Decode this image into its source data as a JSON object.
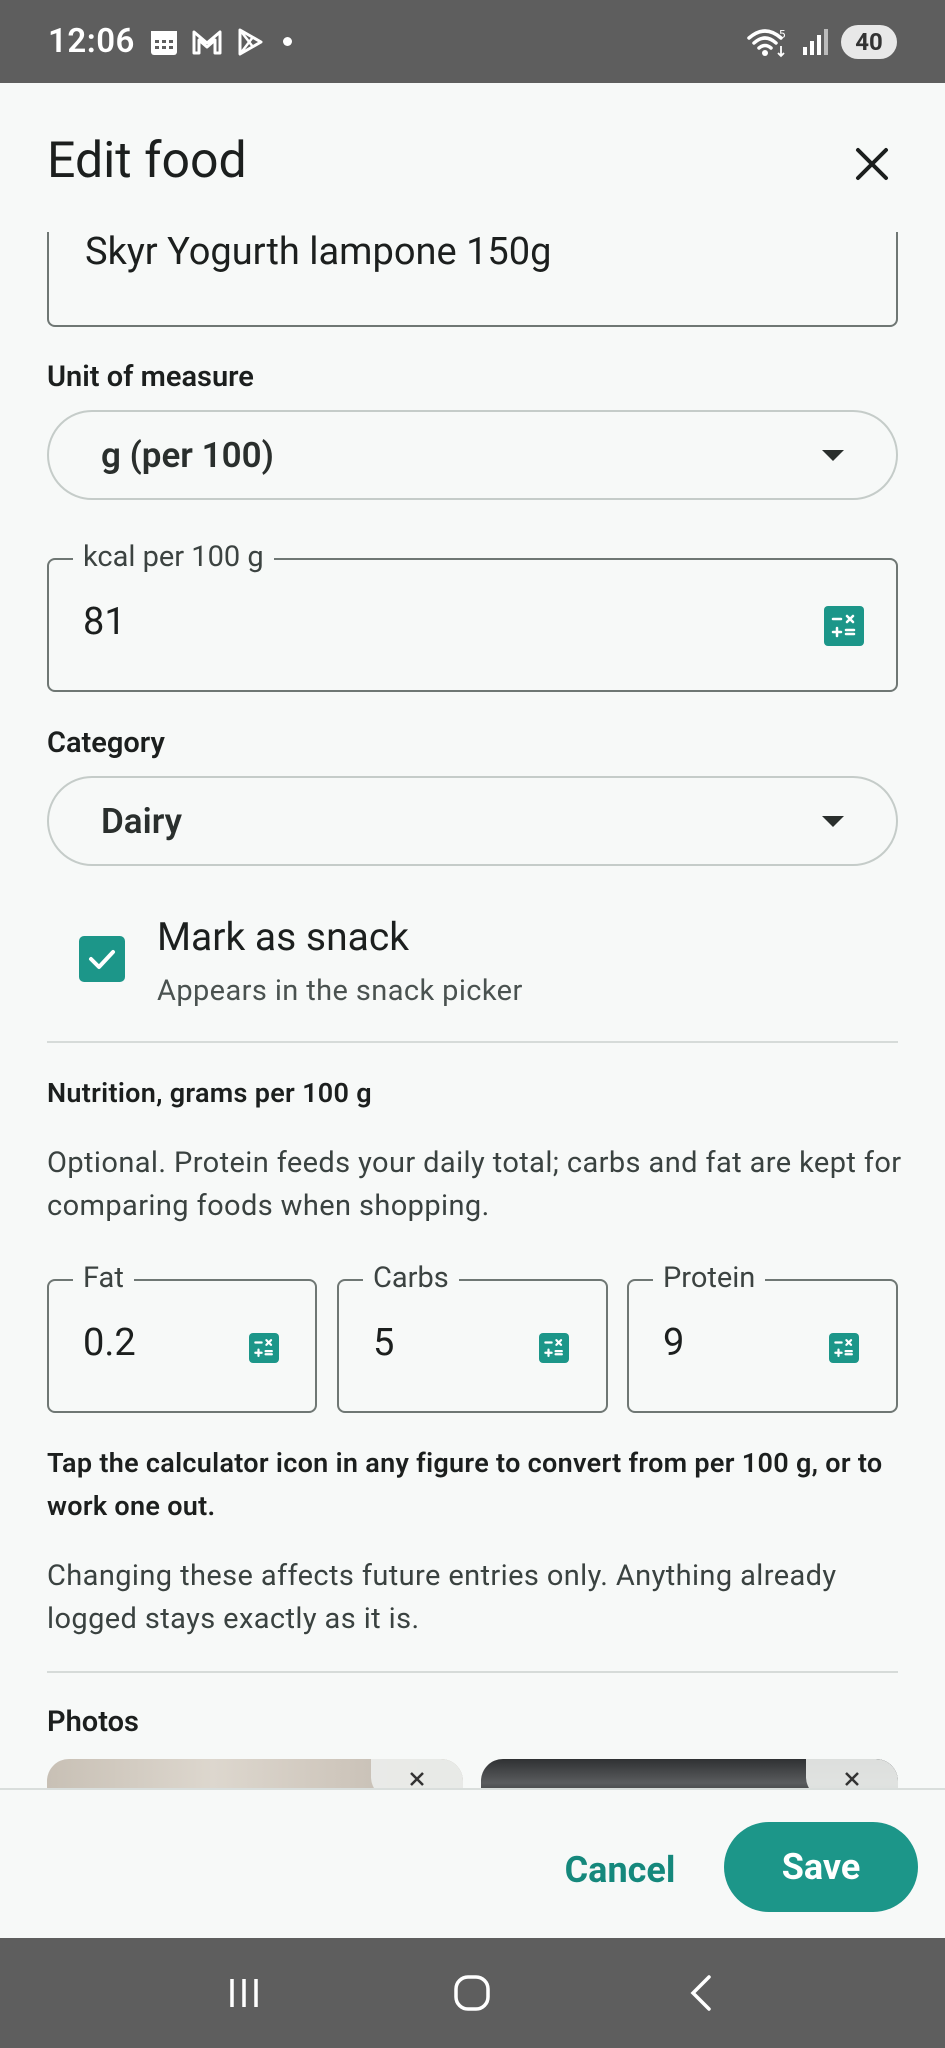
{
  "status_bar": {
    "time": "12:06",
    "battery": "40",
    "network": "5"
  },
  "dialog": {
    "title": "Edit food",
    "close_icon": "close-icon"
  },
  "form": {
    "name_value": "Skyr Yogurth lampone 150g",
    "unit_label": "Unit of measure",
    "unit_value": "g  (per 100)",
    "kcal_label": "kcal per 100 g",
    "kcal_value": "81",
    "category_label": "Category",
    "category_value": "Dairy",
    "snack_title": "Mark as snack",
    "snack_subtitle": "Appears in the snack picker",
    "snack_checked": true,
    "nutrition_title": "Nutrition, grams per 100 g",
    "nutrition_desc": "Optional. Protein feeds your daily total; carbs and fat are kept for comparing foods when shopping.",
    "fat_label": "Fat",
    "fat_value": "0.2",
    "carbs_label": "Carbs",
    "carbs_value": "5",
    "protein_label": "Protein",
    "protein_value": "9",
    "calc_hint": "Tap the calculator icon in any figure to convert from per 100 g, or to work one out.",
    "future_note": "Changing these affects future entries only. Anything already logged stays exactly as it is.",
    "photos_label": "Photos"
  },
  "footer": {
    "cancel_label": "Cancel",
    "save_label": "Save"
  },
  "colors": {
    "accent": "#1c9689",
    "accent_text": "#15887c",
    "system_bar": "#5e5e5e"
  }
}
